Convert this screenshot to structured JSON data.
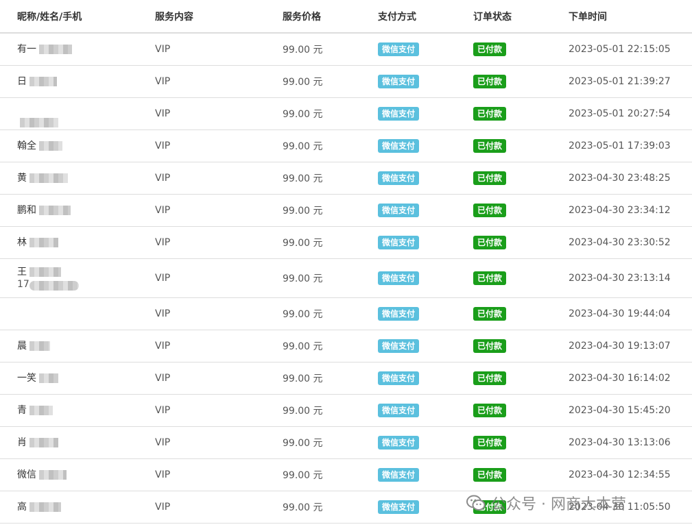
{
  "table": {
    "headers": [
      "昵称/姓名/手机",
      "服务内容",
      "服务价格",
      "支付方式",
      "订单状态",
      "下单时间"
    ],
    "rows": [
      {
        "nickname": "有一",
        "phone": "",
        "service": "VIP",
        "price": "99.00 元",
        "payment": "微信支付",
        "status": "已付款",
        "time": "2023-05-01 22:15:05"
      },
      {
        "nickname": "日",
        "phone": "",
        "service": "VIP",
        "price": "99.00 元",
        "payment": "微信支付",
        "status": "已付款",
        "time": "2023-05-01 21:39:27"
      },
      {
        "nickname": "",
        "phone": "",
        "service": "VIP",
        "price": "99.00 元",
        "payment": "微信支付",
        "status": "已付款",
        "time": "2023-05-01 20:27:54"
      },
      {
        "nickname": "翰全",
        "phone": "",
        "service": "VIP",
        "price": "99.00 元",
        "payment": "微信支付",
        "status": "已付款",
        "time": "2023-05-01 17:39:03"
      },
      {
        "nickname": "黄",
        "phone": "",
        "service": "VIP",
        "price": "99.00 元",
        "payment": "微信支付",
        "status": "已付款",
        "time": "2023-04-30 23:48:25"
      },
      {
        "nickname": "鹏和",
        "phone": "",
        "service": "VIP",
        "price": "99.00 元",
        "payment": "微信支付",
        "status": "已付款",
        "time": "2023-04-30 23:34:12"
      },
      {
        "nickname": "林",
        "phone": "",
        "service": "VIP",
        "price": "99.00 元",
        "payment": "微信支付",
        "status": "已付款",
        "time": "2023-04-30 23:30:52"
      },
      {
        "nickname": "王",
        "phone": "17",
        "service": "VIP",
        "price": "99.00 元",
        "payment": "微信支付",
        "status": "已付款",
        "time": "2023-04-30 23:13:14"
      },
      {
        "nickname": "",
        "phone": "",
        "service": "VIP",
        "price": "99.00 元",
        "payment": "微信支付",
        "status": "已付款",
        "time": "2023-04-30 19:44:04"
      },
      {
        "nickname": "晨",
        "phone": "",
        "service": "VIP",
        "price": "99.00 元",
        "payment": "微信支付",
        "status": "已付款",
        "time": "2023-04-30 19:13:07"
      },
      {
        "nickname": "一笑",
        "phone": "",
        "service": "VIP",
        "price": "99.00 元",
        "payment": "微信支付",
        "status": "已付款",
        "time": "2023-04-30 16:14:02"
      },
      {
        "nickname": "青",
        "phone": "",
        "service": "VIP",
        "price": "99.00 元",
        "payment": "微信支付",
        "status": "已付款",
        "time": "2023-04-30 15:45:20"
      },
      {
        "nickname": "肖",
        "phone": "",
        "service": "VIP",
        "price": "99.00 元",
        "payment": "微信支付",
        "status": "已付款",
        "time": "2023-04-30 13:13:06"
      },
      {
        "nickname": "微信",
        "phone": "",
        "service": "VIP",
        "price": "99.00 元",
        "payment": "微信支付",
        "status": "已付款",
        "time": "2023-04-30 12:34:55"
      },
      {
        "nickname": "高",
        "phone": "",
        "service": "VIP",
        "price": "99.00 元",
        "payment": "微信支付",
        "status": "已付款",
        "time": "2023-04-30 11:05:50"
      }
    ]
  },
  "colors": {
    "wechat_badge": "#5bc0de",
    "paid_badge": "#1a9e1a",
    "border": "#dddddd"
  },
  "watermark": {
    "icon": "wechat-official-account-icon",
    "text": "公众号 · 网商大本营"
  }
}
